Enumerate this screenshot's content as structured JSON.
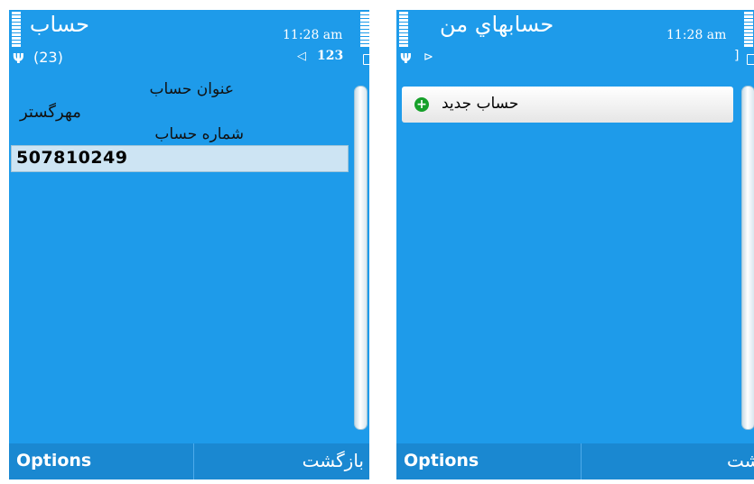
{
  "left_screen": {
    "title": "حساب",
    "time": "11:28 am",
    "count": "(23)",
    "message_count": "123",
    "fields": {
      "account_title_label": "عنوان حساب",
      "account_title_value": "مهرگستر",
      "account_number_label": "شماره حساب",
      "account_number_value": "507810249"
    },
    "softkeys": {
      "left": "Options",
      "right": "بازگشت"
    }
  },
  "right_screen": {
    "title": "حسابهاي من",
    "time": "11:28 am",
    "items": [
      {
        "label": "حساب جديد"
      }
    ],
    "softkeys": {
      "left": "Options",
      "right": "بازگشت"
    }
  },
  "colors": {
    "background": "#1e9bea",
    "softbar": "#1a88d1",
    "highlight": "#cde4f3",
    "add_icon": "#16a02a"
  },
  "icons": [
    "signal-icon",
    "battery-icon",
    "antenna-icon",
    "envelope-icon",
    "phone-icon",
    "add-icon"
  ]
}
